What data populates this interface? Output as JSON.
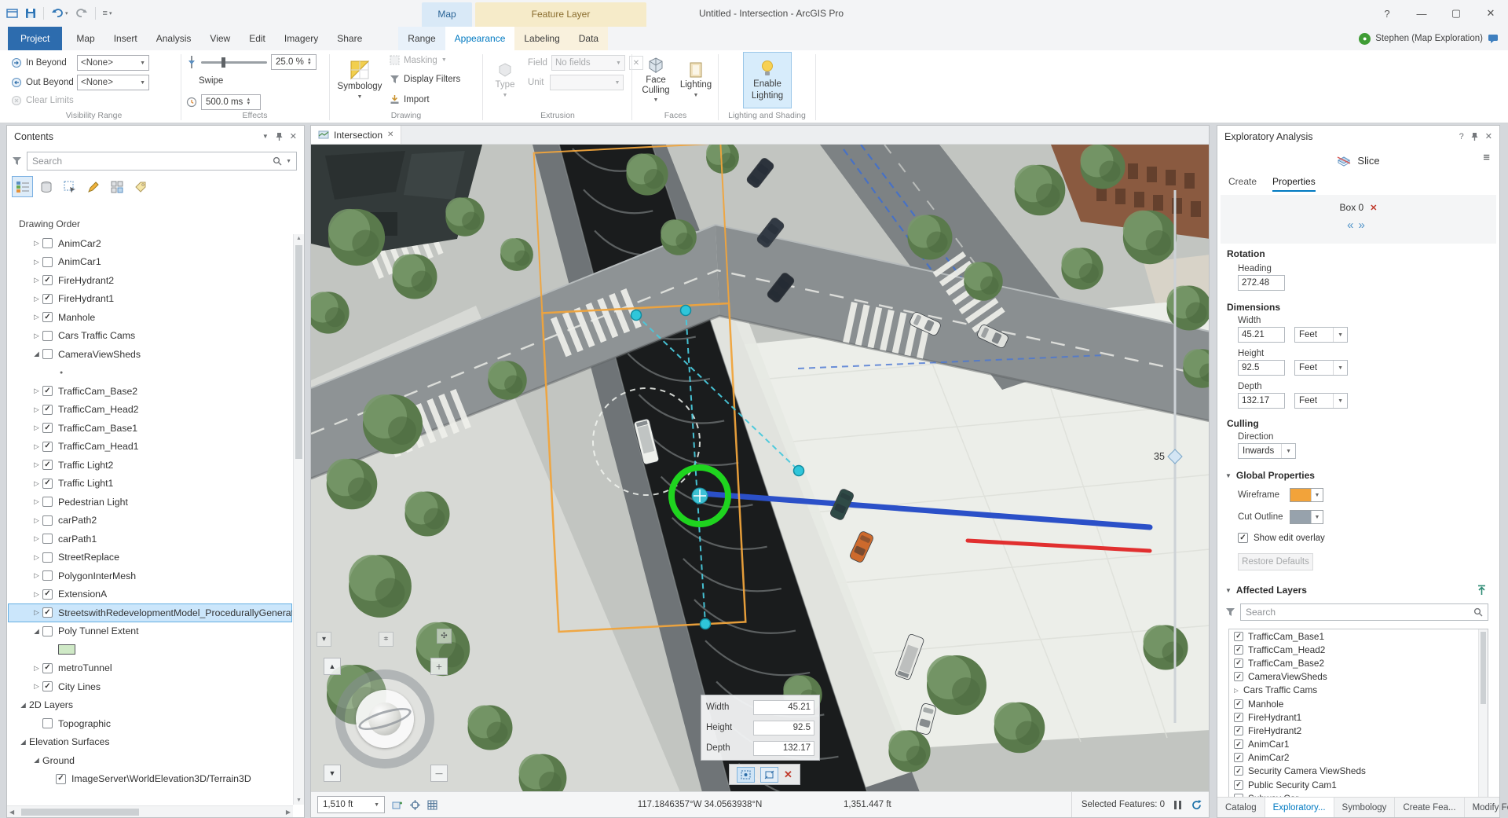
{
  "colors": {
    "accent": "#0079c1",
    "slice_wireframe_orange": "#f0a43c",
    "handle_cyan": "#2fc6da",
    "selection_green": "#1fd41f",
    "project_tab_blue": "#2d6cae"
  },
  "titlebar": {
    "title": "Untitled - Intersection - ArcGIS Pro",
    "help": "?",
    "contextual": {
      "map": "Map",
      "feature_layer": "Feature Layer"
    }
  },
  "user": {
    "name": "Stephen (Map Exploration)"
  },
  "ribbon": {
    "tabs": [
      {
        "label": "Project",
        "cls": "project"
      },
      {
        "label": "Map"
      },
      {
        "label": "Insert"
      },
      {
        "label": "Analysis"
      },
      {
        "label": "View"
      },
      {
        "label": "Edit"
      },
      {
        "label": "Imagery"
      },
      {
        "label": "Share"
      },
      {
        "label": "Range",
        "cls": "ctx-blue"
      },
      {
        "label": "Appearance",
        "cls": "ctx-tan",
        "active": true
      },
      {
        "label": "Labeling",
        "cls": "ctx-tan"
      },
      {
        "label": "Data",
        "cls": "ctx-tan"
      }
    ],
    "visibility_range": {
      "label": "Visibility Range",
      "rows": [
        {
          "label": "In Beyond",
          "value": "<None>"
        },
        {
          "label": "Out Beyond",
          "value": "<None>"
        }
      ],
      "clear": "Clear Limits"
    },
    "effects": {
      "label": "Effects",
      "swipe": "Swipe",
      "percent": "25.0 %",
      "duration": "500.0 ms"
    },
    "drawing": {
      "label": "Drawing",
      "symbology": "Symbology",
      "masking": "Masking",
      "display_filters": "Display Filters",
      "import_label": "Import"
    },
    "extrusion": {
      "label": "Extrusion",
      "type": "Type",
      "field": "Field",
      "field_value": "No fields",
      "unit": "Unit"
    },
    "faces": {
      "label": "Faces",
      "face_culling": "Face Culling",
      "lighting": "Lighting"
    },
    "lighting_shading": {
      "label": "Lighting and Shading",
      "enable_line1": "Enable",
      "enable_line2": "Lighting"
    }
  },
  "contents": {
    "title": "Contents",
    "search_placeholder": "Search",
    "section": "Drawing Order",
    "items": [
      {
        "t": "AnimCar2",
        "cb": false,
        "ex": "c",
        "ind": 1
      },
      {
        "t": "AnimCar1",
        "cb": false,
        "ex": "c",
        "ind": 1
      },
      {
        "t": "FireHydrant2",
        "cb": true,
        "ex": "c",
        "ind": 1
      },
      {
        "t": "FireHydrant1",
        "cb": true,
        "ex": "c",
        "ind": 1
      },
      {
        "t": "Manhole",
        "cb": true,
        "ex": "c",
        "ind": 1
      },
      {
        "t": "Cars Traffic Cams",
        "cb": false,
        "ex": "c",
        "ind": 1
      },
      {
        "t": "CameraViewSheds",
        "cb": false,
        "ex": "e",
        "ind": 1
      },
      {
        "kind": "bullet",
        "ind": 2
      },
      {
        "t": "TrafficCam_Base2",
        "cb": true,
        "ex": "c",
        "ind": 1
      },
      {
        "t": "TrafficCam_Head2",
        "cb": true,
        "ex": "c",
        "ind": 1
      },
      {
        "t": "TrafficCam_Base1",
        "cb": true,
        "ex": "c",
        "ind": 1
      },
      {
        "t": "TrafficCam_Head1",
        "cb": true,
        "ex": "c",
        "ind": 1
      },
      {
        "t": "Traffic Light2",
        "cb": true,
        "ex": "c",
        "ind": 1
      },
      {
        "t": "Traffic Light1",
        "cb": true,
        "ex": "c",
        "ind": 1
      },
      {
        "t": "Pedestrian Light",
        "cb": false,
        "ex": "c",
        "ind": 1
      },
      {
        "t": "carPath2",
        "cb": false,
        "ex": "c",
        "ind": 1
      },
      {
        "t": "carPath1",
        "cb": false,
        "ex": "c",
        "ind": 1
      },
      {
        "t": "StreetReplace",
        "cb": false,
        "ex": "c",
        "ind": 1
      },
      {
        "t": "PolygonInterMesh",
        "cb": false,
        "ex": "c",
        "ind": 1
      },
      {
        "t": "ExtensionA",
        "cb": true,
        "ex": "c",
        "ind": 1
      },
      {
        "t": "StreetswithRedevelopmentModel_ProcedurallyGeneratedM",
        "cb": true,
        "ex": "c",
        "ind": 1,
        "sel": true
      },
      {
        "t": "Poly Tunnel Extent",
        "cb": false,
        "ex": "e",
        "ind": 1
      },
      {
        "kind": "swatch",
        "ind": 2
      },
      {
        "t": "metroTunnel",
        "cb": true,
        "ex": "c",
        "ind": 1
      },
      {
        "t": "City Lines",
        "cb": true,
        "ex": "c",
        "ind": 1
      },
      {
        "t": "2D Layers",
        "ex": "e",
        "ind": 0,
        "kind": "group"
      },
      {
        "t": "Topographic",
        "cb": false,
        "ind": 1
      },
      {
        "t": "Elevation Surfaces",
        "ex": "e",
        "ind": 0,
        "kind": "group"
      },
      {
        "t": "Ground",
        "ex": "e",
        "ind": 1,
        "kind": "group"
      },
      {
        "t": "ImageServer\\WorldElevation3D/Terrain3D",
        "cb": true,
        "ind": 2
      }
    ]
  },
  "map": {
    "tab": "Intersection",
    "slider_value": "35",
    "dim": {
      "width_label": "Width",
      "width": "45.21",
      "height_label": "Height",
      "height": "92.5",
      "depth_label": "Depth",
      "depth": "132.17"
    },
    "status": {
      "scale": "1,510 ft",
      "coords": "117.1846357°W 34.0563938°N",
      "elevation": "1,351.447 ft",
      "selected": "Selected Features: 0"
    }
  },
  "panel": {
    "title": "Exploratory Analysis",
    "tool": "Slice",
    "tabs": [
      {
        "label": "Create"
      },
      {
        "label": "Properties",
        "active": true
      }
    ],
    "box_label": "Box 0",
    "rotation": {
      "title": "Rotation",
      "heading_label": "Heading",
      "heading": "272.48"
    },
    "dimensions": {
      "title": "Dimensions",
      "width_label": "Width",
      "width": "45.21",
      "height_label": "Height",
      "height": "92.5",
      "depth_label": "Depth",
      "depth": "132.17",
      "unit": "Feet"
    },
    "culling": {
      "title": "Culling",
      "direction_label": "Direction",
      "direction": "Inwards"
    },
    "global_props": {
      "title": "Global Properties",
      "wireframe_label": "Wireframe",
      "wireframe_color": "#f2a33a",
      "cut_outline_label": "Cut Outline",
      "cut_outline_color": "#97a2ac",
      "show_edit_overlay": "Show edit overlay",
      "restore": "Restore Defaults"
    },
    "affected": {
      "title": "Affected Layers",
      "search_placeholder": "Search",
      "items": [
        {
          "t": "Subway Car",
          "cb": false
        },
        {
          "t": "Public Security Cam1",
          "cb": true
        },
        {
          "t": "Security Camera ViewSheds",
          "cb": true
        },
        {
          "t": "AnimCar2",
          "cb": true
        },
        {
          "t": "AnimCar1",
          "cb": true
        },
        {
          "t": "FireHydrant2",
          "cb": true
        },
        {
          "t": "FireHydrant1",
          "cb": true
        },
        {
          "t": "Manhole",
          "cb": true
        },
        {
          "t": "Cars Traffic Cams",
          "ex": true
        },
        {
          "t": "CameraViewSheds",
          "cb": true
        },
        {
          "t": "TrafficCam_Base2",
          "cb": true
        },
        {
          "t": "TrafficCam_Head2",
          "cb": true
        },
        {
          "t": "TrafficCam_Base1",
          "cb": true
        }
      ]
    },
    "bottom_tabs": [
      {
        "label": "Catalog"
      },
      {
        "label": "Exploratory...",
        "active": true
      },
      {
        "label": "Symbology"
      },
      {
        "label": "Create Fea..."
      },
      {
        "label": "Modify Fe..."
      }
    ]
  }
}
